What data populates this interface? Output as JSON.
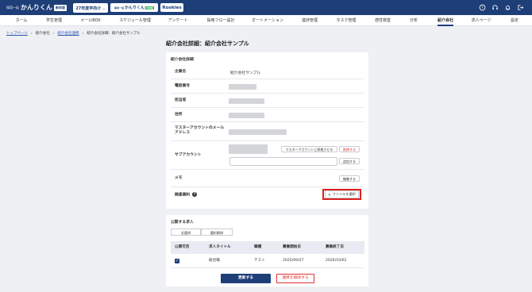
{
  "header": {
    "logo_small": "採用一括",
    "logo_main": "かんりくん",
    "logo_badge": "新卒版",
    "year_select": "27年度卒向け",
    "pill_small": "採用一括",
    "pill_main": "かんりくん",
    "pill_badge": "中途版",
    "rookies": "Rookies"
  },
  "nav": {
    "items": [
      "ホーム",
      "学生管理",
      "メールBOX",
      "スケジュール管理",
      "アンケート",
      "採用フロー設計",
      "オートメーション",
      "進捗管理",
      "タスク管理",
      "適性検査",
      "分析",
      "紹介会社",
      "求人ページ",
      "設定"
    ],
    "active_index": 11
  },
  "breadcrumb": {
    "items": [
      "トップページ",
      "紹介会社",
      "紹介会社連携",
      "紹介会社詳細：紹介会社サンプル"
    ]
  },
  "page_title": "紹介会社詳細：紹介会社サンプル",
  "detail_card": {
    "title": "紹介会社詳細",
    "company_label": "企業名",
    "company_value": "紹介会社サンプル",
    "phone_label": "電話番号",
    "person_label": "担当者",
    "address_label": "住所",
    "master_email_label_1": "マスターアカウントのメール",
    "master_email_label_2": "アドレス",
    "sub_account_label": "サブアカウント",
    "change_to_master": "マスターアカウントに昇格させる",
    "delete": "削除する",
    "add": "追加する",
    "memo_label": "メモ",
    "edit": "編集する",
    "related_docs_label": "関連資料",
    "help": "?",
    "select_file": "ファイルを選択"
  },
  "jobs_card": {
    "title": "公開する求人",
    "select_all": "全選択",
    "deselect": "選択解除",
    "headers": [
      "公開可否",
      "求人タイトル",
      "職種",
      "募集開始日",
      "募集終了日"
    ],
    "rows": [
      {
        "checked": true,
        "title": "総合職",
        "category": "テスト",
        "start": "2025/09/27",
        "end": "2026/10/02"
      }
    ]
  },
  "actions": {
    "update": "更新する",
    "cancel_link": "連携を解除する"
  },
  "colors": {
    "brand": "#1e3e78",
    "highlight": "#e02020",
    "danger": "#d33333"
  }
}
